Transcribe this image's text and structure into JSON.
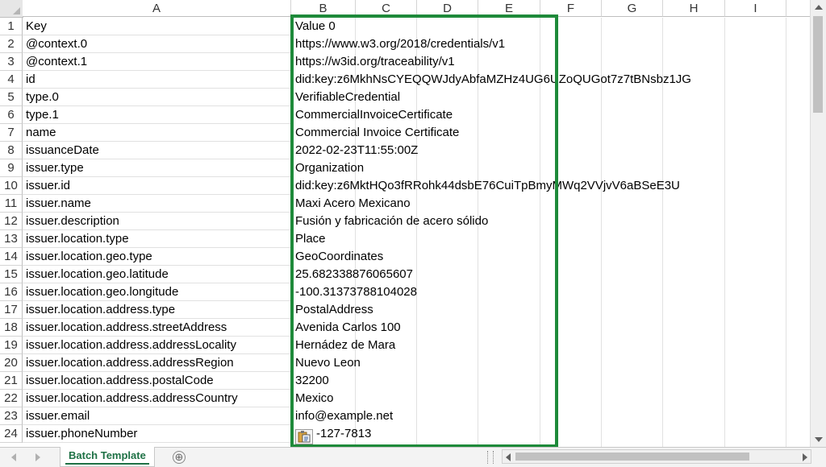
{
  "columns": [
    "A",
    "B",
    "C",
    "D",
    "E",
    "F",
    "G",
    "H",
    "I"
  ],
  "rows": [
    {
      "num": "1",
      "key": "Key",
      "value": "Value 0"
    },
    {
      "num": "2",
      "key": "@context.0",
      "value": "https://www.w3.org/2018/credentials/v1"
    },
    {
      "num": "3",
      "key": "@context.1",
      "value": "https://w3id.org/traceability/v1"
    },
    {
      "num": "4",
      "key": "id",
      "value": "did:key:z6MkhNsCYEQQWJdyAbfaMZHz4UG6UZoQUGot7z7tBNsbz1JG"
    },
    {
      "num": "5",
      "key": "type.0",
      "value": "VerifiableCredential"
    },
    {
      "num": "6",
      "key": "type.1",
      "value": "CommercialInvoiceCertificate"
    },
    {
      "num": "7",
      "key": "name",
      "value": "Commercial Invoice Certificate"
    },
    {
      "num": "8",
      "key": "issuanceDate",
      "value": "2022-02-23T11:55:00Z"
    },
    {
      "num": "9",
      "key": "issuer.type",
      "value": "Organization"
    },
    {
      "num": "10",
      "key": "issuer.id",
      "value": "did:key:z6MktHQo3fRRohk44dsbE76CuiTpBmyMWq2VVjvV6aBSeE3U"
    },
    {
      "num": "11",
      "key": "issuer.name",
      "value": "Maxi Acero Mexicano"
    },
    {
      "num": "12",
      "key": "issuer.description",
      "value": "Fusión y fabricación de acero sólido"
    },
    {
      "num": "13",
      "key": "issuer.location.type",
      "value": "Place"
    },
    {
      "num": "14",
      "key": "issuer.location.geo.type",
      "value": "GeoCoordinates"
    },
    {
      "num": "15",
      "key": "issuer.location.geo.latitude",
      "value": "25.682338876065607"
    },
    {
      "num": "16",
      "key": "issuer.location.geo.longitude",
      "value": "-100.31373788104028"
    },
    {
      "num": "17",
      "key": "issuer.location.address.type",
      "value": "PostalAddress"
    },
    {
      "num": "18",
      "key": "issuer.location.address.streetAddress",
      "value": "Avenida Carlos 100"
    },
    {
      "num": "19",
      "key": "issuer.location.address.addressLocality",
      "value": "Hernádez de Mara"
    },
    {
      "num": "20",
      "key": "issuer.location.address.addressRegion",
      "value": "Nuevo Leon"
    },
    {
      "num": "21",
      "key": "issuer.location.address.postalCode",
      "value": "32200"
    },
    {
      "num": "22",
      "key": "issuer.location.address.addressCountry",
      "value": "Mexico"
    },
    {
      "num": "23",
      "key": "issuer.email",
      "value": "info@example.net"
    },
    {
      "num": "24",
      "key": "issuer.phoneNumber",
      "value": "-127-7813"
    }
  ],
  "sheet_tab": "Batch Template",
  "add_sheet": "⊕",
  "highlight_color": "#1e8a3a",
  "tab_color": "#1e7145",
  "icons": {
    "paste_options": "paste-options-icon",
    "add_sheet": "add-sheet-icon"
  }
}
